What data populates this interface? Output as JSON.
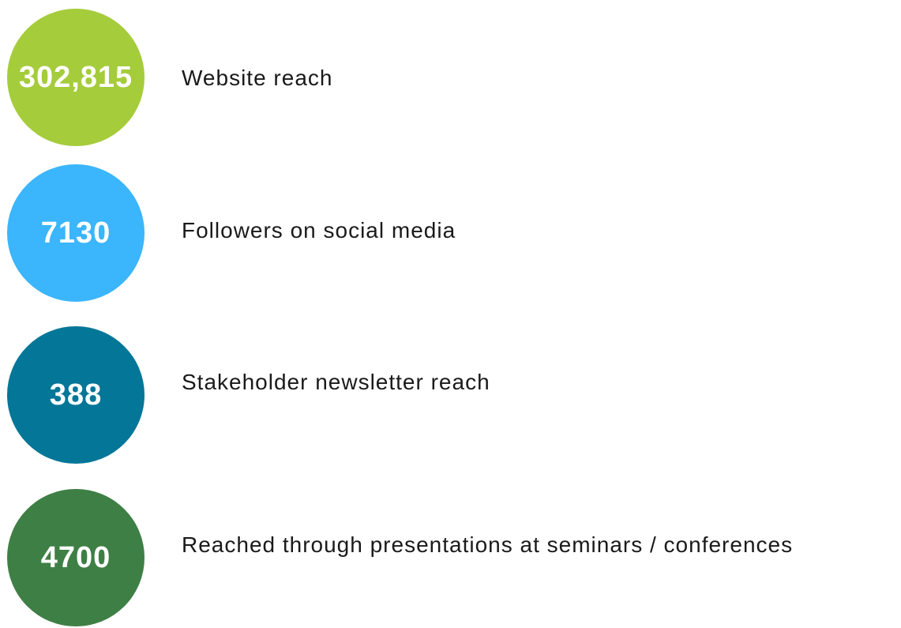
{
  "stats": [
    {
      "value": "302,815",
      "label": "Website reach",
      "color": "#a5cc3b"
    },
    {
      "value": "7130",
      "label": "Followers on social media",
      "color": "#3bb5fc"
    },
    {
      "value": "388",
      "label": "Stakeholder newsletter reach",
      "color": "#047698"
    },
    {
      "value": "4700",
      "label": "Reached through presentations at seminars / conferences",
      "color": "#3e7f45"
    }
  ]
}
